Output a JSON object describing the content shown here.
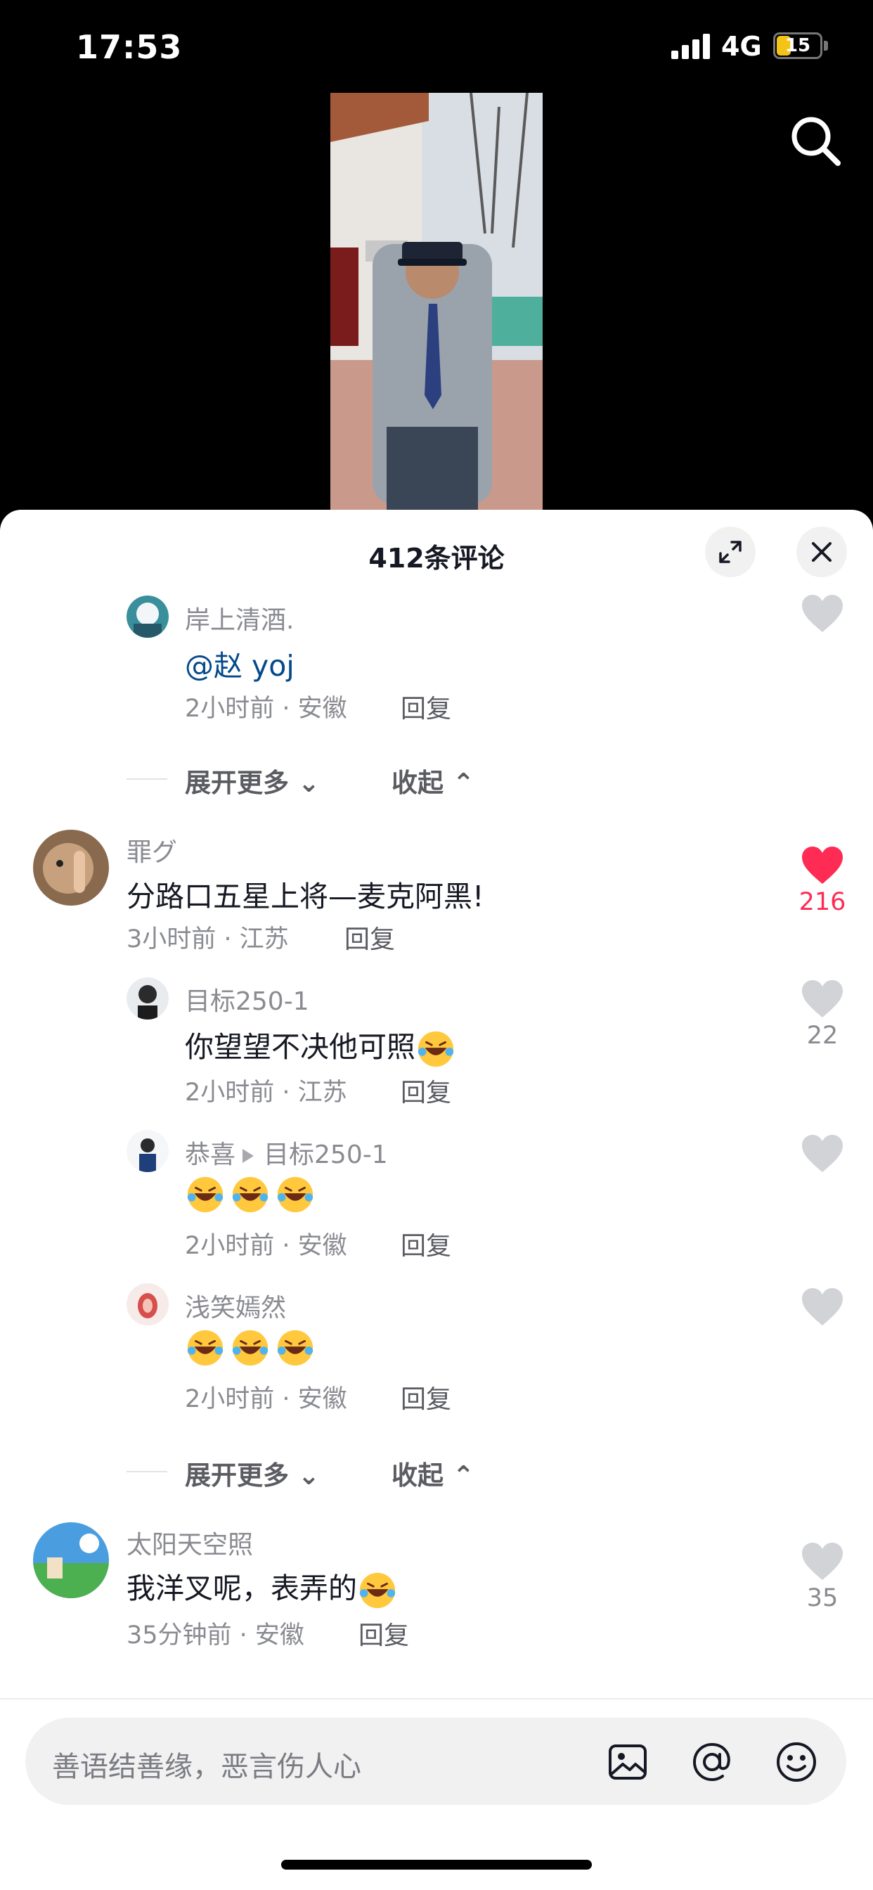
{
  "status_bar": {
    "time": "17:53",
    "network": "4G",
    "battery": "15"
  },
  "sheet": {
    "title": "412条评论",
    "comments": [
      {
        "name": "岸上清酒.",
        "mention": "@赵 yoj",
        "meta": "2小时前 · 安徽",
        "reply": "回复"
      },
      {
        "name": "罪グ",
        "text": "分路口五星上将—麦克阿黑!",
        "meta": "3小时前 · 江苏",
        "reply": "回复",
        "likes": "216"
      },
      {
        "name": "目标250-1",
        "text": "你望望不决他可照",
        "meta": "2小时前 · 江苏",
        "reply": "回复",
        "likes": "22"
      },
      {
        "name": "恭喜",
        "reply_to": "目标250-1",
        "meta": "2小时前 · 安徽",
        "reply": "回复"
      },
      {
        "name": "浅笑嫣然",
        "meta": "2小时前 · 安徽",
        "reply": "回复"
      },
      {
        "name": "太阳天空照",
        "text": "我洋叉呢，表弄的",
        "meta": "35分钟前 · 安徽",
        "reply": "回复",
        "likes": "35"
      }
    ],
    "expand_more": "展开更多",
    "collapse": "收起"
  },
  "input": {
    "placeholder": "善语结善缘，恶言伤人心"
  },
  "colors": {
    "accent_red": "#fe2c55",
    "mention_blue": "#04498d",
    "secondary_text": "#8a8b91"
  },
  "icons": [
    "search-icon",
    "expand-icon",
    "close-icon",
    "heart-icon",
    "image-icon",
    "at-icon",
    "emoji-icon",
    "laugh-cry-emoji"
  ]
}
